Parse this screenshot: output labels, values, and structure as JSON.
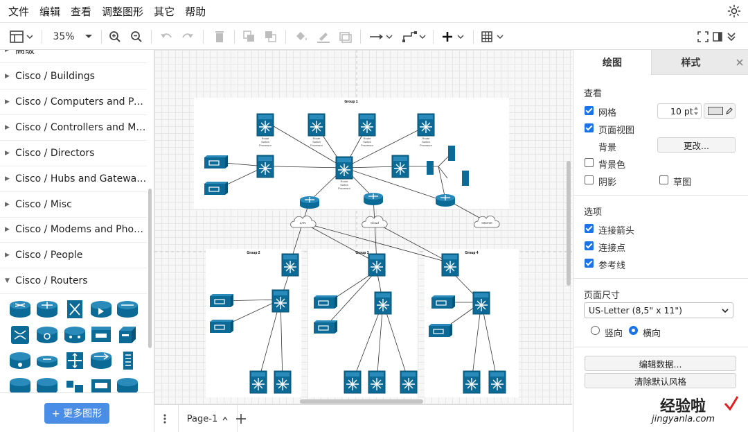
{
  "menu": [
    "文件",
    "编辑",
    "查看",
    "调整图形",
    "其它",
    "帮助"
  ],
  "toolbar": {
    "zoom": "35%"
  },
  "sidebar": {
    "partial_top": "高级",
    "libraries": [
      {
        "label": "Cisco / Buildings",
        "expanded": false
      },
      {
        "label": "Cisco / Computers and Peripherals",
        "expanded": false
      },
      {
        "label": "Cisco / Controllers and Modules",
        "expanded": false
      },
      {
        "label": "Cisco / Directors",
        "expanded": false
      },
      {
        "label": "Cisco / Hubs and Gateways",
        "expanded": false
      },
      {
        "label": "Cisco / Misc",
        "expanded": false
      },
      {
        "label": "Cisco / Modems and Phones",
        "expanded": false
      },
      {
        "label": "Cisco / People",
        "expanded": false
      },
      {
        "label": "Cisco / Routers",
        "expanded": true
      }
    ],
    "more_shapes": "+ 更多图形"
  },
  "diagram": {
    "groups": [
      "Group 1",
      "Group 2",
      "Group 3",
      "Group 4"
    ],
    "clouds": [
      "LAN",
      "Cloud",
      "Internet"
    ],
    "switch_caption": [
      "Route",
      "Switch",
      "Processor"
    ]
  },
  "pagebar": {
    "page": "Page-1"
  },
  "panel": {
    "tabs": [
      "绘图",
      "样式"
    ],
    "view_title": "查看",
    "grid": "网格",
    "grid_size": "10 pt",
    "page_view": "页面视图",
    "background": "背景",
    "change_btn": "更改...",
    "bg_color": "背景色",
    "shadow": "阴影",
    "sketch": "草图",
    "options_title": "选项",
    "connection_arrows": "连接箭头",
    "connection_points": "连接点",
    "guides": "参考线",
    "page_size_title": "页面尺寸",
    "page_size": "US-Letter (8,5\" x 11\")",
    "portrait": "竖向",
    "landscape": "横向",
    "edit_data": "编辑数据...",
    "clear_style": "清除默认风格"
  },
  "watermark": {
    "title": "经验啦",
    "url": "jingyanla.com"
  },
  "colors": {
    "accent": "#1a73e8",
    "shape": "#0b6a96",
    "button": "#4a8de6"
  }
}
